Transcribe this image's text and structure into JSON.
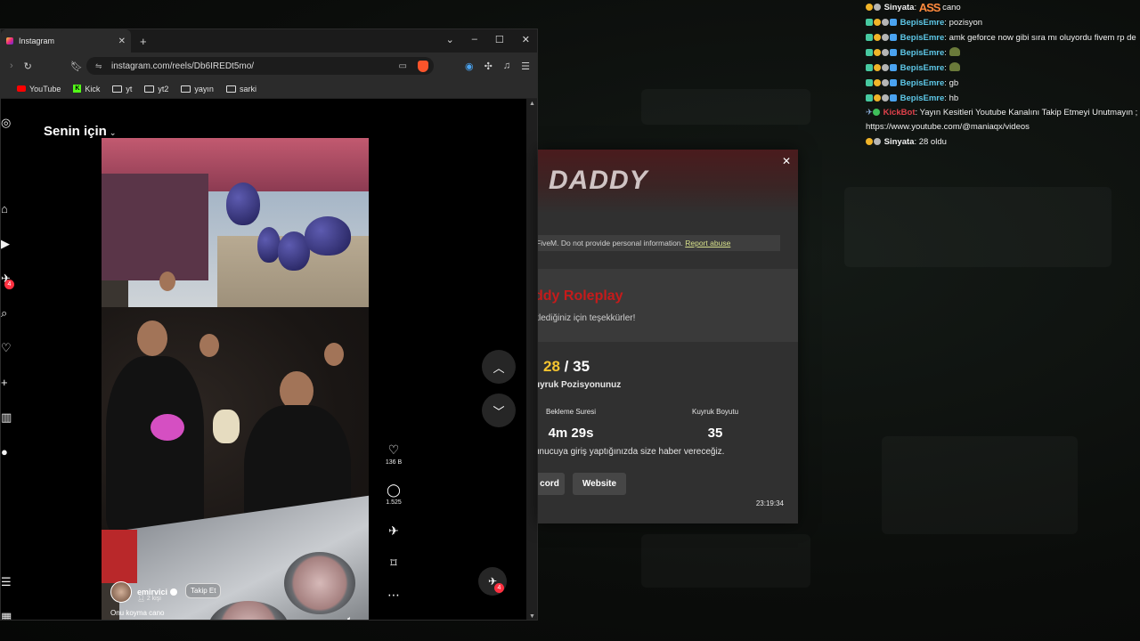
{
  "browser": {
    "tab_title": "Instagram",
    "url": "instagram.com/reels/Db6IREDt5mo/",
    "bookmarks": [
      "YouTube",
      "Kick",
      "yt",
      "yt2",
      "yayın",
      "sarki"
    ]
  },
  "instagram": {
    "feed_title": "Senin için",
    "messages_badge": "4",
    "reel": {
      "username": "emirvici",
      "people": "2 kişi",
      "follow_label": "Takip Et",
      "caption": "Onu koyma cano"
    },
    "actions": {
      "likes": "136 B",
      "comments": "1.525"
    },
    "fab_badge": "4"
  },
  "fivem_dialog": {
    "logo": "DADDY",
    "warning": "FiveM. Do not provide personal information.",
    "report_label": "Report abuse",
    "server_name": "ddy Roleplay",
    "thanks": "klediğiniz için teşekkürler!",
    "queue_current": "28",
    "queue_sep": "/",
    "queue_total": "35",
    "queue_label": "uyruk Pozisyonunuz",
    "wait_label": "Bekleme Suresi",
    "wait_value": "4m 29s",
    "size_label": "Kuyruk Boyutu",
    "size_value": "35",
    "notify_text": "unucuya giriş yaptığınızda size haber vereceğiz.",
    "discord_label": "cord",
    "website_label": "Website",
    "time": "23:19:34"
  },
  "chat": [
    {
      "user": "Sinyata",
      "sep": ":",
      "emote": "ASS",
      "text": "cano"
    },
    {
      "user": "BepisEmre",
      "sep": ":",
      "text": "pozisyon"
    },
    {
      "user": "BepisEmre",
      "sep": ":",
      "text": "amk geforce now gibi sıra mı oluyordu fivem rp de"
    },
    {
      "user": "BepisEmre",
      "sep": ":",
      "text": ""
    },
    {
      "user": "BepisEmre",
      "sep": ":",
      "text": ""
    },
    {
      "user": "BepisEmre",
      "sep": ":",
      "text": "gb"
    },
    {
      "user": "BepisEmre",
      "sep": ":",
      "text": "hb"
    },
    {
      "user": "KickBot",
      "sep": ":",
      "text": "Yayın Kesitleri Youtube Kanalını Takip Etmeyi Unutmayın ; https://www.youtube.com/@maniaqx/videos"
    },
    {
      "user": "Sinyata",
      "sep": ":",
      "text": "28 oldu"
    }
  ],
  "colors": {
    "accent_red": "#c51b1b",
    "queue_yellow": "#f4c430",
    "bepis_blue": "#5ec8e8",
    "kickbot_red": "#e0414b"
  }
}
